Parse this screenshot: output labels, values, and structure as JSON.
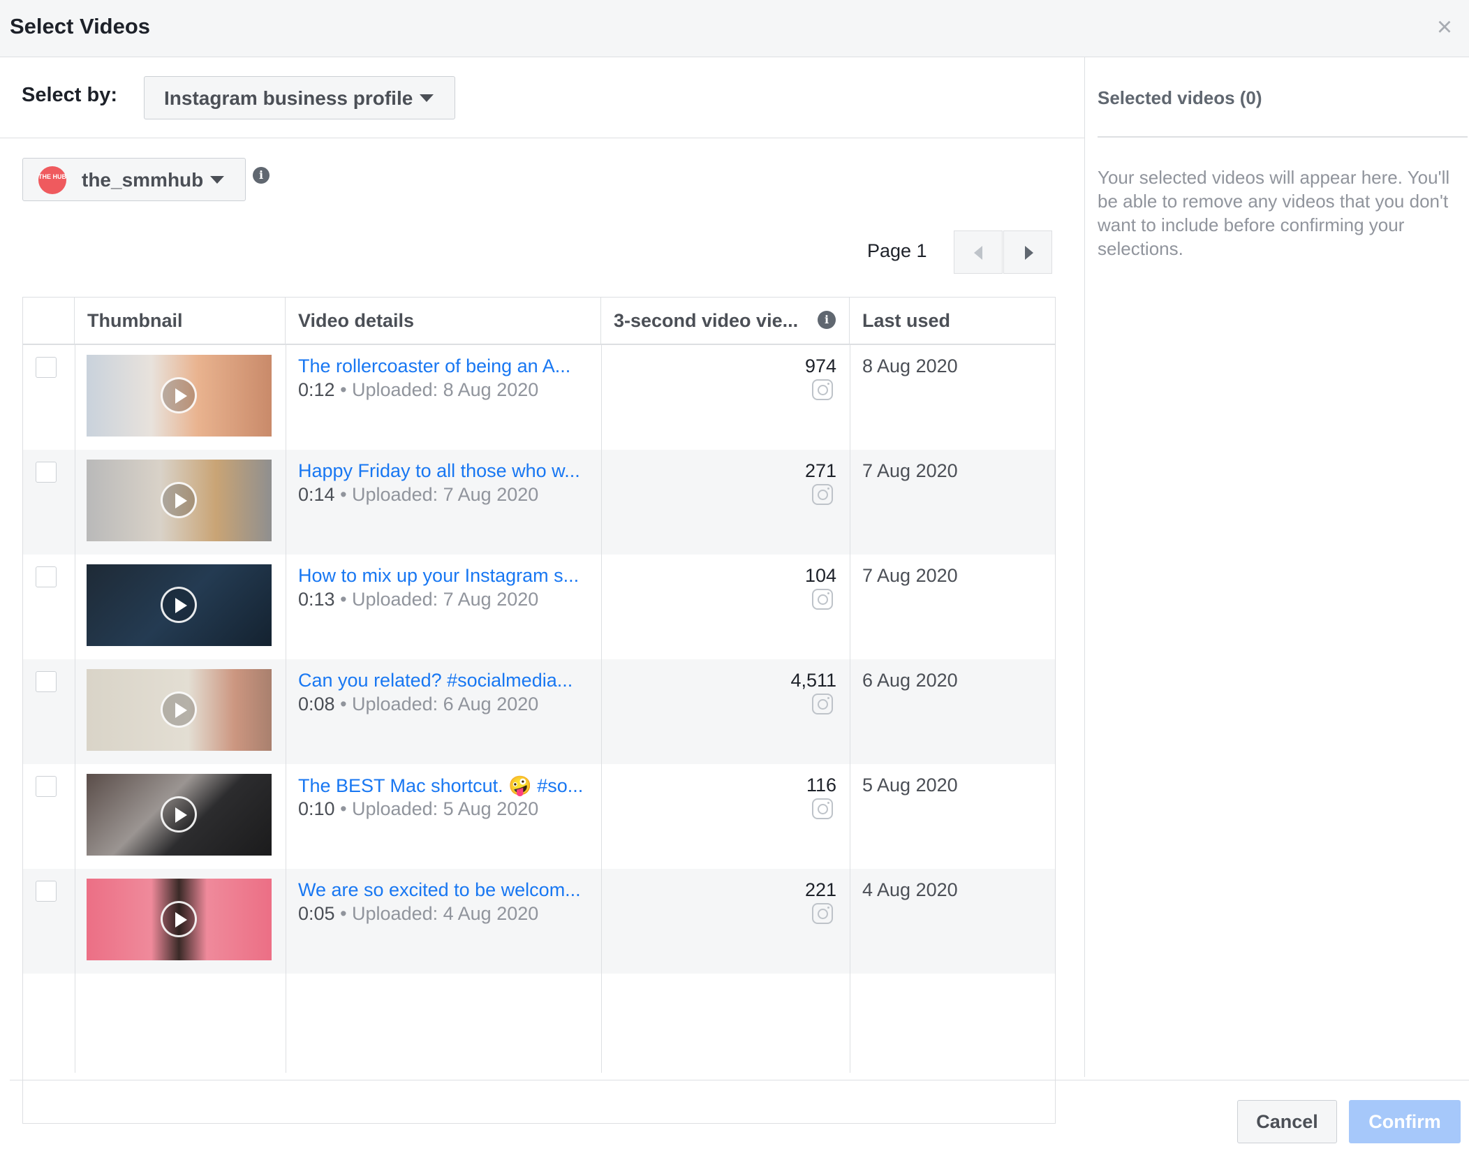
{
  "dialog": {
    "title": "Select Videos"
  },
  "select_by": {
    "label": "Select by:",
    "value": "Instagram business profile"
  },
  "account": {
    "name": "the_smmhub",
    "avatar_text": "THE HUB"
  },
  "pagination": {
    "label": "Page 1"
  },
  "table": {
    "headers": [
      "Thumbnail",
      "Video details",
      "3-second video vie...",
      "Last used"
    ],
    "rows": [
      {
        "title": "The rollercoaster of being an A...",
        "duration": "0:12",
        "uploaded": "Uploaded: 8 Aug 2020",
        "views": "974",
        "last_used": "8 Aug 2020",
        "thumb": "woman-hand-on-chin"
      },
      {
        "title": "Happy Friday to all those who w...",
        "duration": "0:14",
        "uploaded": "Uploaded: 7 Aug 2020",
        "views": "271",
        "last_used": "7 Aug 2020",
        "thumb": "person-laughing"
      },
      {
        "title": "How to mix up your Instagram s...",
        "duration": "0:13",
        "uploaded": "Uploaded: 7 Aug 2020",
        "views": "104",
        "last_used": "7 Aug 2020",
        "thumb": "letter-tiles"
      },
      {
        "title": "Can you related? #socialmedia...",
        "duration": "0:08",
        "uploaded": "Uploaded: 6 Aug 2020",
        "views": "4,511",
        "last_used": "6 Aug 2020",
        "thumb": "handwriting-pen"
      },
      {
        "title": "The BEST Mac shortcut. 🤪 #so...",
        "duration": "0:10",
        "uploaded": "Uploaded: 5 Aug 2020",
        "views": "116",
        "last_used": "5 Aug 2020",
        "thumb": "laptop-keyboard"
      },
      {
        "title": "We are so excited to be welcom...",
        "duration": "0:05",
        "uploaded": "Uploaded: 4 Aug 2020",
        "views": "221",
        "last_used": "4 Aug 2020",
        "thumb": "woman-pink-background"
      }
    ]
  },
  "selected_panel": {
    "title": "Selected videos (0)",
    "empty_text": "Your selected videos will appear here. You'll be able to remove any videos that you don't want to include before confirming your selections."
  },
  "footer": {
    "cancel_label": "Cancel",
    "confirm_label": "Confirm"
  },
  "colors": {
    "link": "#1877f2",
    "confirm_disabled": "#a6c8fa",
    "avatar": "#ef5a5e"
  }
}
